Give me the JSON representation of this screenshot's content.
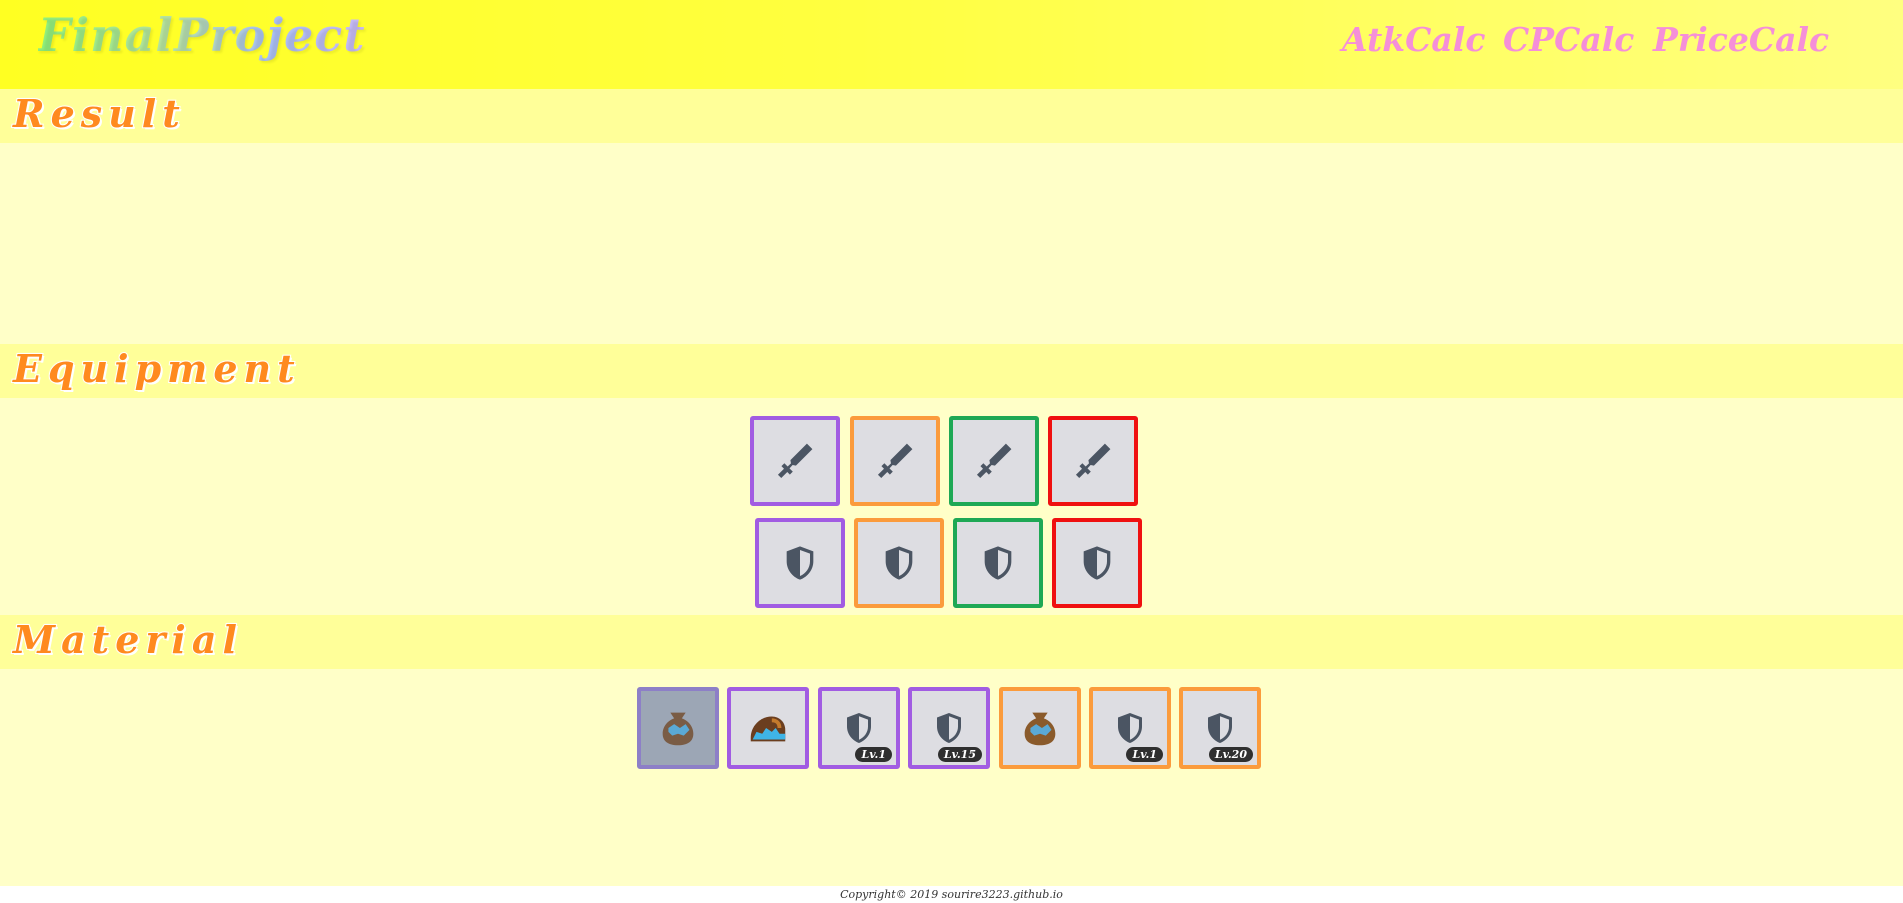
{
  "header": {
    "logo": "FinalProject",
    "nav": [
      "AtkCalc",
      "CPCalc",
      "PriceCalc"
    ]
  },
  "sections": {
    "result": "Result",
    "equipment": "Equipment",
    "material": "Material"
  },
  "equipment": {
    "weapons": [
      {
        "rarity": "purple",
        "icon": "sword-icon"
      },
      {
        "rarity": "orange",
        "icon": "sword-icon"
      },
      {
        "rarity": "green",
        "icon": "sword-icon"
      },
      {
        "rarity": "red",
        "icon": "sword-icon"
      }
    ],
    "armors": [
      {
        "rarity": "purple",
        "icon": "shield-icon"
      },
      {
        "rarity": "orange",
        "icon": "shield-icon"
      },
      {
        "rarity": "green",
        "icon": "shield-icon"
      },
      {
        "rarity": "red",
        "icon": "shield-icon"
      }
    ]
  },
  "materials": [
    {
      "rarity": "grey",
      "icon": "gem-bag-icon",
      "level": ""
    },
    {
      "rarity": "purple",
      "icon": "gem-pouch-icon",
      "level": ""
    },
    {
      "rarity": "purple",
      "icon": "shield-icon",
      "level": "Lv.1"
    },
    {
      "rarity": "purple",
      "icon": "shield-icon",
      "level": "Lv.15"
    },
    {
      "rarity": "orange",
      "icon": "gem-bag-icon",
      "level": ""
    },
    {
      "rarity": "orange",
      "icon": "shield-icon",
      "level": "Lv.1"
    },
    {
      "rarity": "orange",
      "icon": "shield-icon",
      "level": "Lv.20"
    }
  ],
  "footer": "Copyright© 2019 sourire3223.github.io",
  "colors": {
    "purple": "#a15ce2",
    "orange": "#fb9b3c",
    "green": "#1ea855",
    "red": "#ef1010",
    "grey": "#8d7fc7"
  }
}
